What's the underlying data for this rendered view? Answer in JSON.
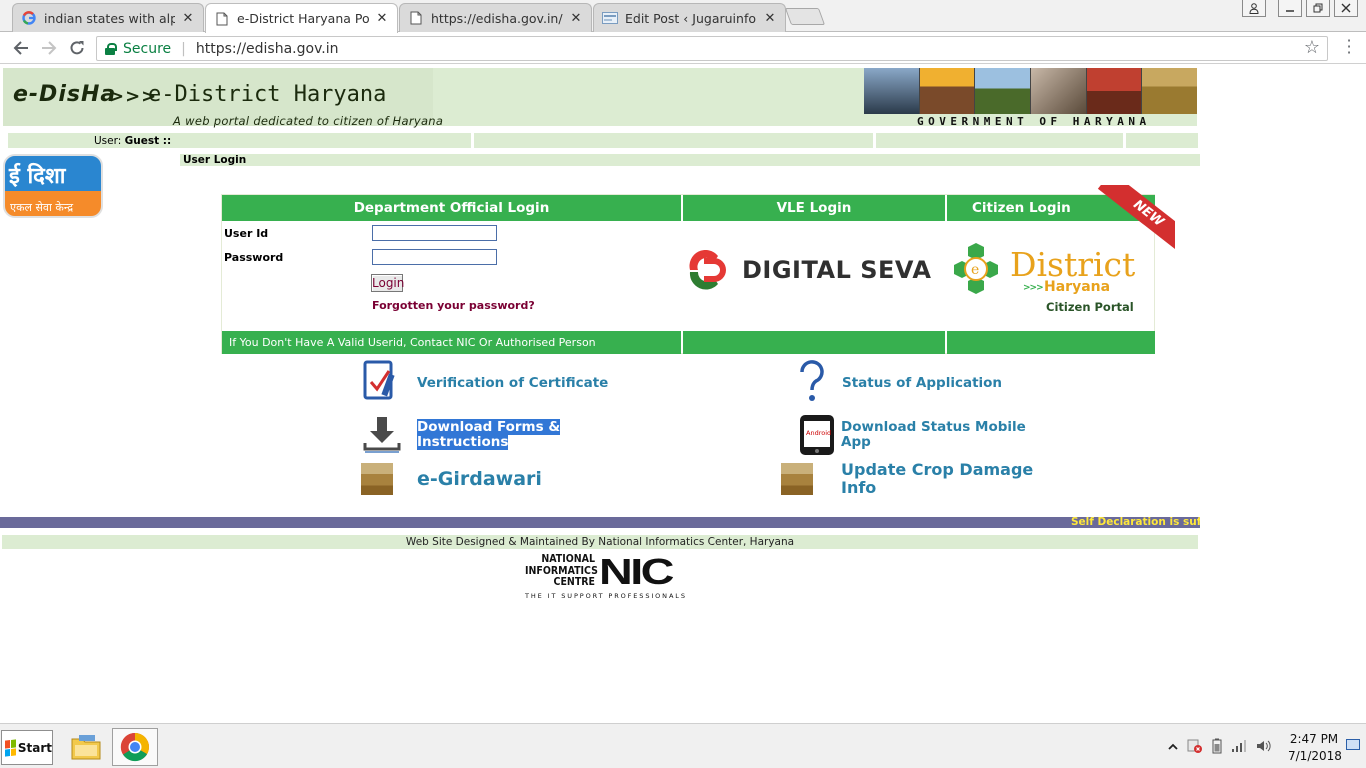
{
  "browser": {
    "tabs": [
      {
        "title": "indian states with alphab",
        "favicon": "google-icon",
        "active": false
      },
      {
        "title": "e-District Haryana Portal",
        "favicon": "page-icon",
        "active": true
      },
      {
        "title": "https://edisha.gov.in/Dov",
        "favicon": "page-icon",
        "active": false
      },
      {
        "title": "Edit Post ‹ Jugaruinfo — V",
        "favicon": "wordpress-icon",
        "active": false
      }
    ],
    "close_glyph": "✕",
    "secure_label": "Secure",
    "url": "https://edisha.gov.in"
  },
  "header": {
    "logo_edisha": "e-DisHa",
    "logo_arrows": ">>>",
    "logo_title": "e-District Haryana",
    "logo_subtitle": "A web portal dedicated to citizen of Haryana",
    "government_text": "GOVERNMENT OF HARYANA"
  },
  "userbar": {
    "user_label": "User:",
    "user_value": "Guest ::"
  },
  "edisha_icon": {
    "top_text": "ई दिशा",
    "bottom_text": "एकल सेवा केन्द्र"
  },
  "user_login_title": "User Login",
  "login_panel": {
    "dept_header": "Department Official Login",
    "vle_header": "VLE Login",
    "citizen_header": "Citizen Login",
    "new_badge": "NEW",
    "userid_label": "User Id",
    "password_label": "Password",
    "userid_value": "",
    "password_value": "",
    "login_button": "Login",
    "forgot_link": "Forgotten your password?",
    "footer_note": "If You Don't Have A Valid Userid, Contact NIC Or Authorised Person",
    "digital_seva_text": "DIGITAL SEVA",
    "edistrict_word": "District",
    "edistrict_state": "Haryana",
    "edistrict_portal": "Citizen Portal"
  },
  "links": {
    "verification": "Verification of Certificate",
    "status": "Status of Application",
    "download_forms_1": "Download Forms &",
    "download_forms_2": "Instructions",
    "download_app_1": "Download Status Mobile",
    "download_app_2": "App",
    "girdawari": "e-Girdawari",
    "crop_damage_1": "Update Crop Damage",
    "crop_damage_2": "Info",
    "phone_label": "Android"
  },
  "marquee_text": "Self Declaration is suffici",
  "footer": {
    "credit": "Web Site Designed & Maintained By National Informatics Center, Haryana",
    "nic_line1": "NATIONAL",
    "nic_line2": "INFORMATICS",
    "nic_line3": "CENTRE",
    "nic_abbr": "NIC",
    "nic_tagline": "THE IT SUPPORT PROFESSIONALS"
  },
  "taskbar": {
    "start_label": "Start",
    "time": "2:47 PM",
    "date": "7/1/2018"
  },
  "colors": {
    "green_header": "#37b04f",
    "light_green": "#dcecd2",
    "link_blue": "#2a80a8",
    "maroon": "#7a0033",
    "marquee_bg": "#6a6a9a",
    "marquee_text": "#ffe83a"
  }
}
